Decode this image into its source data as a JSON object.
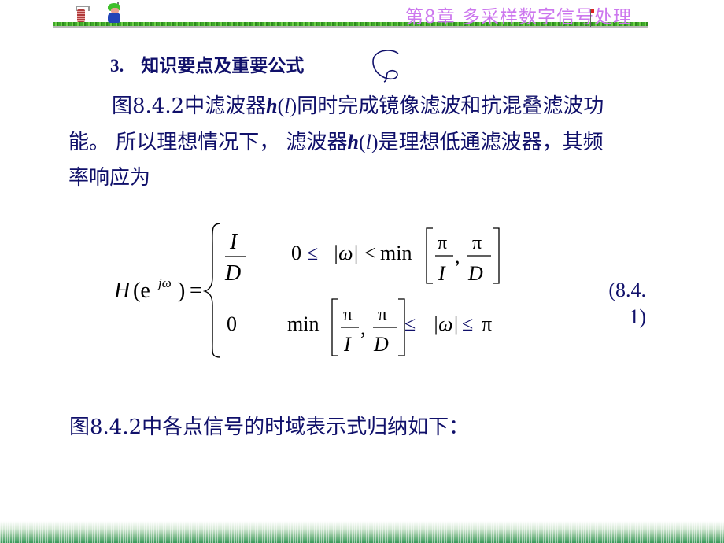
{
  "header": {
    "chapter_title": "第8章  多采样数字信号处理"
  },
  "section": {
    "number": "3.",
    "title": "知识要点及重要公式"
  },
  "paragraph": {
    "line1_a": "图8.4.2中滤波器",
    "line1_h": "h",
    "line1_paren_open": "(",
    "line1_l": "l",
    "line1_paren_close": ")",
    "line1_b": "同时完成镜像滤波和抗混叠滤波功",
    "line2_a": "能。 所以理想情况下，  滤波器",
    "line2_h": "h",
    "line2_paren_open": "(",
    "line2_l": "l",
    "line2_paren_close": ")",
    "line2_b": "是理想低通滤波器，其频",
    "line3": "率响应为"
  },
  "formula": {
    "lhs_H": "H",
    "lhs_open": "(e",
    "lhs_sup": "jω",
    "lhs_close": ")",
    "equals": "=",
    "case1_num": "I",
    "case1_den": "D",
    "case1_cond_zero": "0",
    "case1_cond_leq": "≤",
    "case1_cond_omega": "|ω|",
    "case1_cond_lt": "<",
    "case1_cond_min": "min",
    "case2_value": "0",
    "case2_cond_min": "min",
    "case2_cond_leq1": "≤",
    "case2_cond_omega": "|ω|",
    "case2_cond_leq2": "≤",
    "case2_cond_pi": "π",
    "frac_pi": "π",
    "frac_I": "I",
    "frac_D": "D",
    "comma": ","
  },
  "equation_number": {
    "line1": "(8.4.",
    "line2": "1)"
  },
  "summary": "图8.4.2中各点信号的时域表示式归纳如下："
}
